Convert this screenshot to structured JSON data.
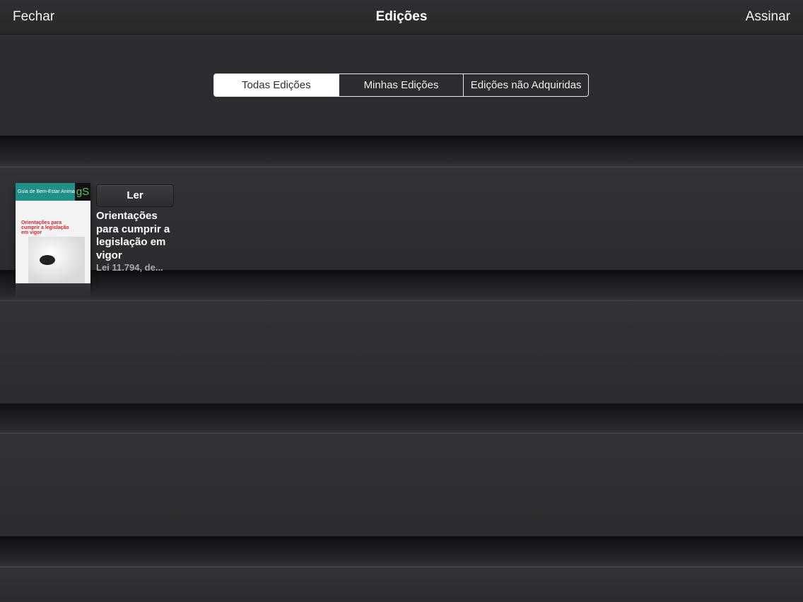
{
  "navbar": {
    "close_label": "Fechar",
    "title": "Edições",
    "subscribe_label": "Assinar"
  },
  "filter": {
    "segments": [
      {
        "label": "Todas Edições",
        "selected": true
      },
      {
        "label": "Minhas Edições",
        "selected": false
      },
      {
        "label": "Edições não Adquiridas",
        "selected": false
      }
    ]
  },
  "issues": [
    {
      "cover": {
        "brand": "Guia de Bem-Estar Animal",
        "logo": "gS",
        "headline": "Orientações para cumprir a legislação em vigor"
      },
      "read_label": "Ler",
      "title": "Orientações para cumprir a legislação em vigor",
      "subtitle": "Lei 11.794, de..."
    }
  ],
  "colors": {
    "background": "#2d2e31",
    "cover_accent": "#1f8f88",
    "headline_red": "#d0252e"
  }
}
